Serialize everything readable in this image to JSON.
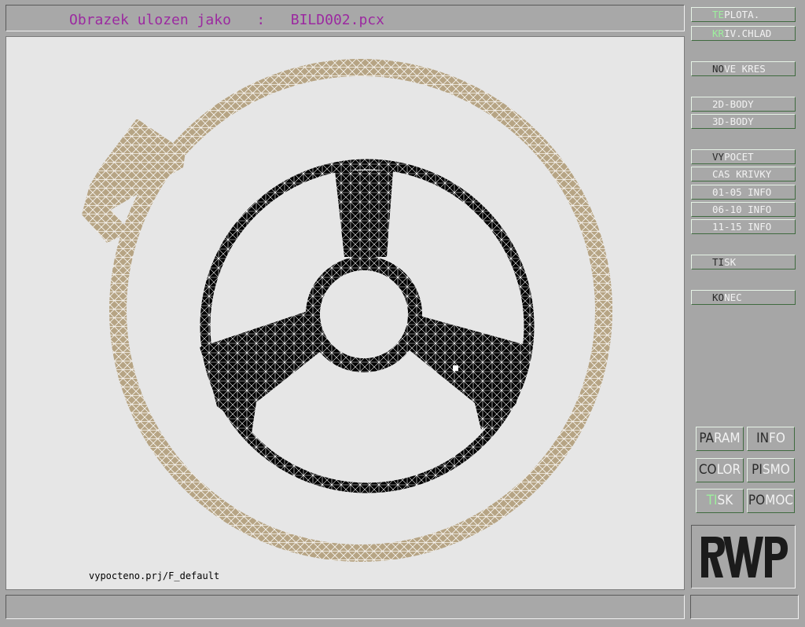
{
  "title": {
    "text": "Obrazek ulozen jako   :   BILD002.pcx"
  },
  "canvas": {
    "project_label": "vypocteno.prj/F_default",
    "colors": {
      "background": "#e6e6e6",
      "ring": "#b6a484",
      "wheel": "#000000",
      "mesh": "#ffffff"
    }
  },
  "menu": [
    {
      "hot": "TE",
      "rest": "PLOTA.",
      "style": "gh"
    },
    {
      "hot": "KR",
      "rest": "IV.CHLAD",
      "style": "gh"
    },
    {
      "hot": "NO",
      "rest": "VE KRES",
      "style": "dk"
    },
    {
      "hot": "",
      "rest": "2D-BODY",
      "style": "dk"
    },
    {
      "hot": "",
      "rest": "3D-BODY",
      "style": "dk"
    },
    {
      "hot": "VY",
      "rest": "POCET",
      "style": "dk"
    },
    {
      "hot": "",
      "rest": "CAS KRIVKY",
      "style": "dk"
    },
    {
      "hot": "",
      "rest": "01-05 INFO",
      "style": "dk"
    },
    {
      "hot": "",
      "rest": "06-10 INFO",
      "style": "dk"
    },
    {
      "hot": "",
      "rest": "11-15 INFO",
      "style": "dk"
    },
    {
      "hot": "TI",
      "rest": "SK",
      "style": "dk"
    },
    {
      "hot": "KO",
      "rest": "NEC",
      "style": "dk"
    }
  ],
  "buttons": [
    {
      "hot": "PA",
      "rest": "RAM",
      "style": "dk"
    },
    {
      "hot": "IN",
      "rest": "FO",
      "style": "dk"
    },
    {
      "hot": "CO",
      "rest": "LOR",
      "style": "dk"
    },
    {
      "hot": "PI",
      "rest": "SMO",
      "style": "dk"
    },
    {
      "hot": "TI",
      "rest": "SK",
      "style": "gh"
    },
    {
      "hot": "PO",
      "rest": "MOC",
      "style": "dk"
    }
  ],
  "logo": {
    "text": "RWP"
  }
}
